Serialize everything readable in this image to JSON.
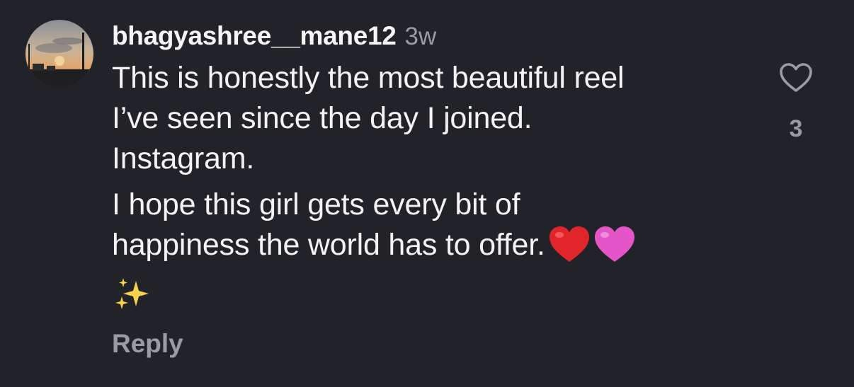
{
  "comment": {
    "username": "bhagyashree__mane12",
    "timestamp": "3w",
    "paragraphs": [
      {
        "lines": [
          "This is honestly the most beautiful reel",
          "I’ve seen since the day I joined.",
          "Instagram."
        ]
      },
      {
        "lines": [
          "I hope this girl gets every bit of",
          "happiness the world has to offer."
        ]
      }
    ],
    "emojis": [
      "red-heart-emoji",
      "pink-heart-emoji",
      "sparkles-emoji"
    ],
    "reply_label": "Reply",
    "like_count": "3"
  },
  "icons": {
    "like": "heart-outline-icon",
    "avatar": "profile-photo-sunset"
  },
  "colors": {
    "background": "#212328",
    "text": "#f3f3f3",
    "muted": "#9a9ca1",
    "red_heart": "#e0262b",
    "pink_heart": "#e455c8",
    "sparkle": "#f7d24a"
  }
}
